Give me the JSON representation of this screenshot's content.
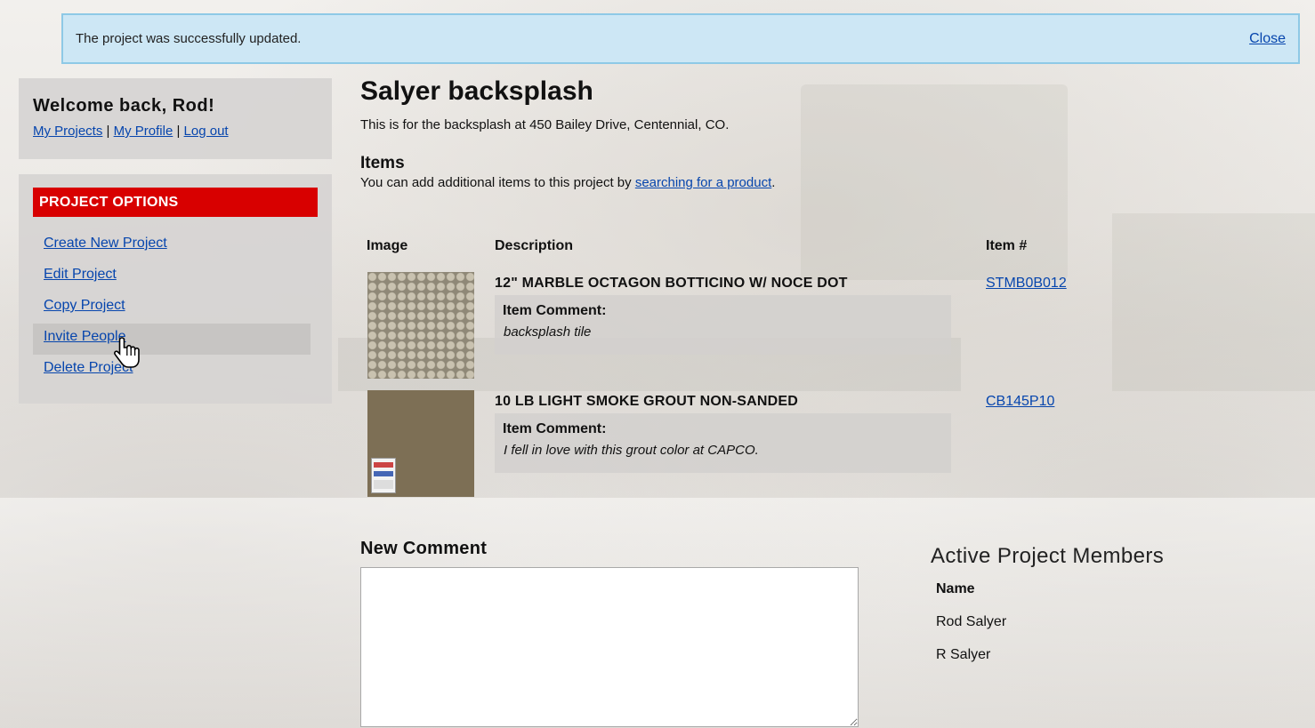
{
  "flash": {
    "message": "The project was successfully updated.",
    "close_label": "Close"
  },
  "welcome": {
    "title": "Welcome back, Rod!",
    "links": [
      "My Projects",
      "My Profile",
      "Log out"
    ],
    "separator": "|"
  },
  "options": {
    "header": "PROJECT OPTIONS",
    "items": [
      "Create New Project",
      "Edit Project",
      "Copy Project",
      "Invite People",
      "Delete Project"
    ],
    "hovered_index": 3
  },
  "project": {
    "title": "Salyer backsplash",
    "description": "This is for the backsplash at 450 Bailey Drive, Centennial, CO."
  },
  "items": {
    "section_title": "Items",
    "help_prefix": "You can add additional items to this project by ",
    "help_link": "searching for a product",
    "help_suffix": ".",
    "columns": [
      "Image",
      "Description",
      "Item #"
    ],
    "comment_label": "Item Comment:",
    "rows": [
      {
        "description": "12\" MARBLE OCTAGON BOTTICINO W/ NOCE DOT",
        "comment": "backsplash tile",
        "item_number": "STMB0B012",
        "image_icon": "marble-mosaic-thumbnail"
      },
      {
        "description": "10 LB LIGHT SMOKE GROUT NON-SANDED",
        "comment": "I fell in love with this grout color at CAPCO.",
        "item_number": "CB145P10",
        "image_icon": "grout-swatch-thumbnail"
      }
    ]
  },
  "new_comment": {
    "title": "New Comment",
    "value": ""
  },
  "members": {
    "title": "Active Project Members",
    "column": "Name",
    "list": [
      "Rod Salyer",
      "R Salyer"
    ]
  },
  "colors": {
    "flash_bg": "#cde7f5",
    "flash_border": "#8ec9e6",
    "options_header": "#d80000",
    "link": "#0645ad"
  }
}
